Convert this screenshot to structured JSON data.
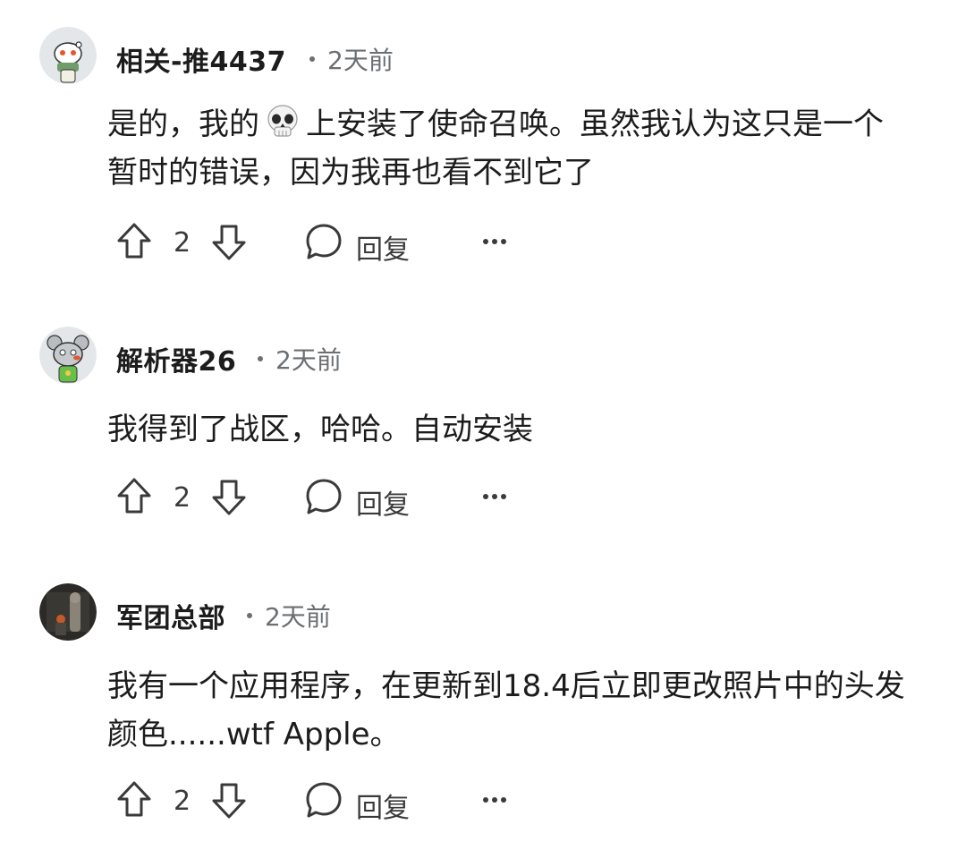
{
  "comments": [
    {
      "username": "相关-推4437",
      "time": "2天前",
      "text_before": "是的，我的",
      "text_emoji": "skull-emoji",
      "text_after": "上安装了使命召唤。虽然我认为这只是一个暂时的错误，因为我再也看不到它了",
      "votes": "2",
      "reply_label": "回复",
      "avatar": "snoo-avatar-scarf-icon"
    },
    {
      "username": "解析器26",
      "time": "2天前",
      "text": "我得到了战区，哈哈。自动安装",
      "votes": "2",
      "reply_label": "回复",
      "avatar": "snoo-avatar-mouse-icon"
    },
    {
      "username": "军团总部",
      "time": "2天前",
      "text": "我有一个应用程序，在更新到18.4后立即更改照片中的头发颜色......wtf Apple。",
      "votes": "2",
      "reply_label": "回复",
      "avatar": "dark-photo-avatar-icon"
    }
  ],
  "colors": {
    "text": "#1c1c1c",
    "meta": "#6b6f73",
    "icon": "#3a3a3a"
  }
}
